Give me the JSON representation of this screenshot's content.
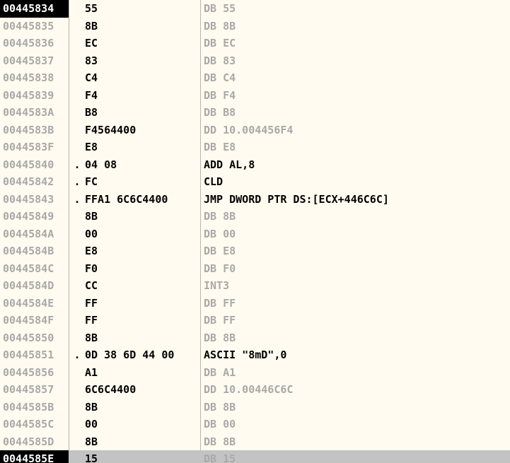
{
  "rows": [
    {
      "address": "00445834",
      "mark": "",
      "bytes": "55",
      "disasm": "DB 55",
      "kind": "data"
    },
    {
      "address": "00445835",
      "mark": "",
      "bytes": "8B",
      "disasm": "DB 8B",
      "kind": "data"
    },
    {
      "address": "00445836",
      "mark": "",
      "bytes": "EC",
      "disasm": "DB EC",
      "kind": "data"
    },
    {
      "address": "00445837",
      "mark": "",
      "bytes": "83",
      "disasm": "DB 83",
      "kind": "data"
    },
    {
      "address": "00445838",
      "mark": "",
      "bytes": "C4",
      "disasm": "DB C4",
      "kind": "data"
    },
    {
      "address": "00445839",
      "mark": "",
      "bytes": "F4",
      "disasm": "DB F4",
      "kind": "data"
    },
    {
      "address": "0044583A",
      "mark": "",
      "bytes": "B8",
      "disasm": "DB B8",
      "kind": "data"
    },
    {
      "address": "0044583B",
      "mark": "",
      "bytes": "F4564400",
      "disasm": "DD 10.004456F4",
      "kind": "data"
    },
    {
      "address": "0044583F",
      "mark": "",
      "bytes": "E8",
      "disasm": "DB E8",
      "kind": "data"
    },
    {
      "address": "00445840",
      "mark": ".",
      "bytes": "04 08",
      "disasm": "ADD AL,8",
      "kind": "code"
    },
    {
      "address": "00445842",
      "mark": ".",
      "bytes": "FC",
      "disasm": "CLD",
      "kind": "code"
    },
    {
      "address": "00445843",
      "mark": ".",
      "bytes": "FFA1 6C6C4400",
      "disasm": "JMP DWORD PTR DS:[ECX+446C6C]",
      "kind": "code"
    },
    {
      "address": "00445849",
      "mark": "",
      "bytes": "8B",
      "disasm": "DB 8B",
      "kind": "data"
    },
    {
      "address": "0044584A",
      "mark": "",
      "bytes": "00",
      "disasm": "DB 00",
      "kind": "data"
    },
    {
      "address": "0044584B",
      "mark": "",
      "bytes": "E8",
      "disasm": "DB E8",
      "kind": "data"
    },
    {
      "address": "0044584C",
      "mark": "",
      "bytes": "F0",
      "disasm": "DB F0",
      "kind": "data"
    },
    {
      "address": "0044584D",
      "mark": "",
      "bytes": "CC",
      "disasm": "INT3",
      "kind": "data"
    },
    {
      "address": "0044584E",
      "mark": "",
      "bytes": "FF",
      "disasm": "DB FF",
      "kind": "data"
    },
    {
      "address": "0044584F",
      "mark": "",
      "bytes": "FF",
      "disasm": "DB FF",
      "kind": "data"
    },
    {
      "address": "00445850",
      "mark": "",
      "bytes": "8B",
      "disasm": "DB 8B",
      "kind": "data"
    },
    {
      "address": "00445851",
      "mark": ".",
      "bytes": "0D 38 6D 44 00",
      "disasm": "ASCII \"8mD\",0",
      "kind": "code"
    },
    {
      "address": "00445856",
      "mark": "",
      "bytes": "A1",
      "disasm": "DB A1",
      "kind": "data"
    },
    {
      "address": "00445857",
      "mark": "",
      "bytes": "6C6C4400",
      "disasm": "DD 10.00446C6C",
      "kind": "data"
    },
    {
      "address": "0044585B",
      "mark": "",
      "bytes": "8B",
      "disasm": "DB 8B",
      "kind": "data"
    },
    {
      "address": "0044585C",
      "mark": "",
      "bytes": "00",
      "disasm": "DB 00",
      "kind": "data"
    },
    {
      "address": "0044585D",
      "mark": "",
      "bytes": "8B",
      "disasm": "DB 8B",
      "kind": "data"
    },
    {
      "address": "0044585E",
      "mark": "",
      "bytes": "15",
      "disasm": "DB 15",
      "kind": "data"
    }
  ],
  "selected_index": 26,
  "colors": {
    "background": "#fffbf0",
    "selected_row": "#c3c3c3",
    "address_gray": "#a9a9a9",
    "code_text": "#000000",
    "divider": "#b9b5aa"
  }
}
